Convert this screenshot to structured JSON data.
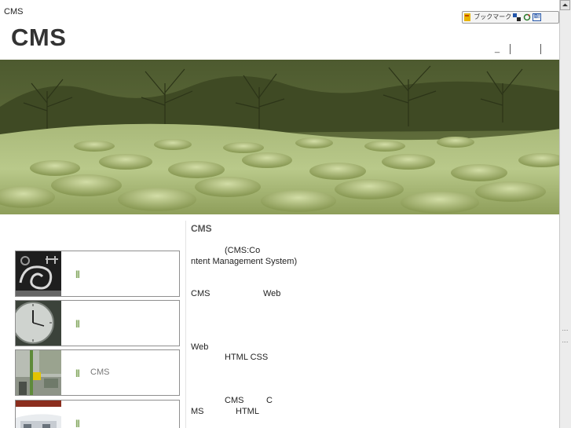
{
  "site": {
    "label": "CMS",
    "title": "CMS"
  },
  "toolbar": {
    "bookmark_label": "ブックマーク",
    "badge": "B!"
  },
  "header_nav": {
    "item": "_"
  },
  "sidebar": {
    "items": [
      {
        "bars": "|||",
        "text": ""
      },
      {
        "bars": "|||",
        "text": ""
      },
      {
        "bars": "|||",
        "text": "CMS"
      },
      {
        "bars": "|||",
        "text": ""
      }
    ]
  },
  "content": {
    "heading": "CMS",
    "lines": [
      "(CMS:Co",
      "ntent Management System)",
      "CMS",
      "Web",
      "Web",
      "HTML CSS",
      "CMS",
      "C",
      "MS",
      "HTML"
    ]
  },
  "colors": {
    "accent": "#5a8a2a",
    "hero_tint": "#b4c488"
  }
}
